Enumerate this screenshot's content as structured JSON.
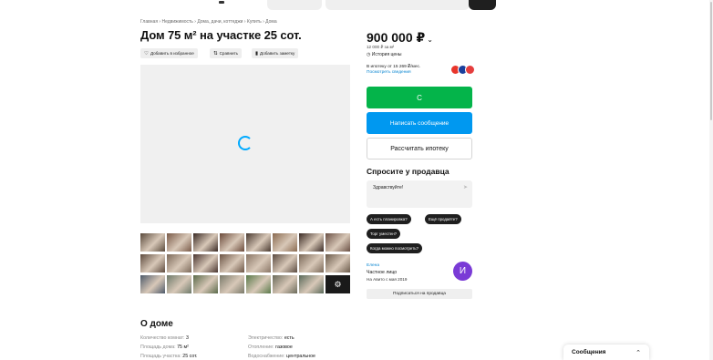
{
  "listing": {
    "breadcrumb": "Главная › Недвижимость › Дома, дачи, коттеджи › Купить › Дома",
    "title": "Дом 75 м² на участке 25 сот.",
    "actions": {
      "favorite": "Добавить в избранное",
      "compare": "Сравнить",
      "note": "Добавить заметку"
    },
    "thumbnails": {
      "row1": [
        "#5a4a3c",
        "#7a5a48",
        "#3a2a24",
        "#6b4a3a",
        "#4a3a30",
        "#8a6a50",
        "#3b2b25",
        "#6a5044"
      ],
      "row2": [
        "#5e4b3e",
        "#7d6a5a",
        "#4a3530",
        "#6c5444",
        "#8a7666",
        "#5a4a40",
        "#7a6858",
        "#6a5a4a"
      ],
      "row3": [
        "#4e5a6a",
        "#6e7a6a",
        "#5a6a4a",
        "#7a7a6a",
        "#5a7a4a",
        "#6a6a5a",
        "#5a6a5a"
      ],
      "more_icon": "gear-icon"
    },
    "about": {
      "title": "О доме",
      "left": [
        {
          "label": "Количество комнат:",
          "value": "3"
        },
        {
          "label": "Площадь дома:",
          "value": "75 м²"
        },
        {
          "label": "Площадь участка:",
          "value": "25 сот."
        }
      ],
      "right": [
        {
          "label": "Электричество:",
          "value": "есть"
        },
        {
          "label": "Отопление:",
          "value": "газовое"
        },
        {
          "label": "Водоснабжение:",
          "value": "центральное"
        }
      ]
    }
  },
  "sidebar": {
    "price": "900 000 ₽",
    "price_per_meter": "12 000 ₽ за м²",
    "price_history": "История цены",
    "mortgage_info": "В ипотеку от 15 269 ₽/мес.",
    "mortgage_link": "Посмотреть сведения",
    "buttons": {
      "call": "С",
      "message": "Написать сообщение",
      "mortgage": "Рассчитать ипотеку"
    },
    "ask": {
      "title": "Спросите у продавца",
      "text": "Здравствуйте!",
      "chips": [
        "А есть планировка?",
        "Ещё продаёте?",
        "Торг уместен?",
        "Когда можно посмотреть?"
      ]
    },
    "seller": {
      "name": "Елена",
      "type": "Частное лицо",
      "since": "На Авито с мая 2019",
      "avatar_letter": "И",
      "subscribe": "Подписаться на продавца"
    }
  },
  "messages": {
    "label": "Сообщения"
  },
  "colors": {
    "call_green": "#04b44a",
    "message_blue": "#0098f0",
    "link_blue": "#0a86d1",
    "spinner_blue": "#00aaff",
    "avatar_purple": "#7a3bd6"
  }
}
